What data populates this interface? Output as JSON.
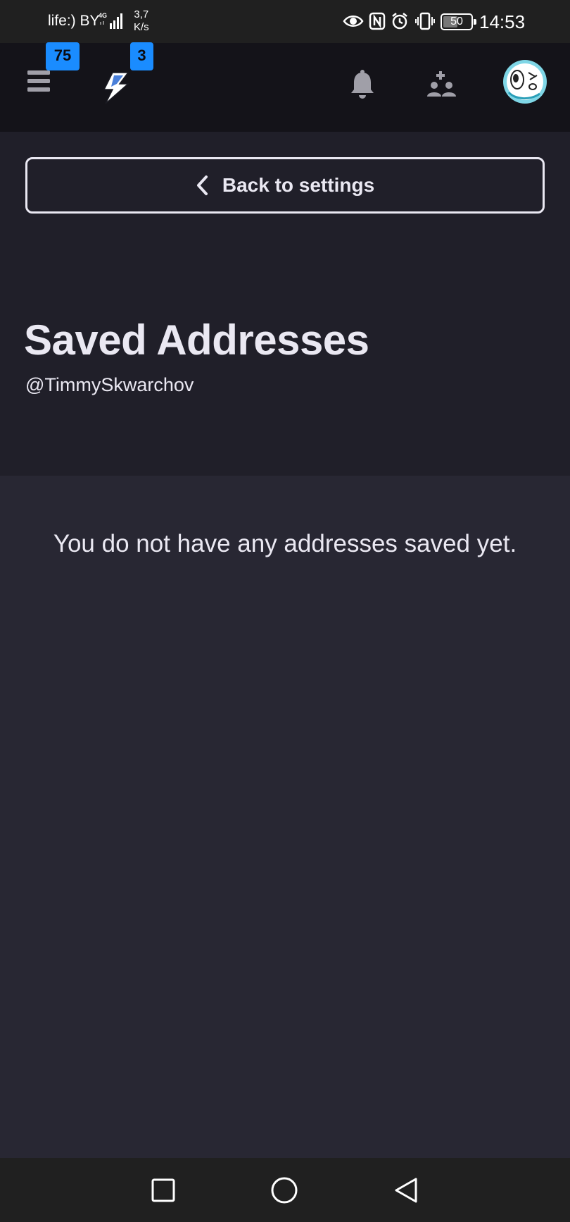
{
  "status_bar": {
    "carrier": "life:) BY",
    "network": "4G",
    "speed_value": "3,7",
    "speed_unit": "K/s",
    "battery": "50",
    "time": "14:53",
    "icons": [
      "eye-icon",
      "nfc-icon",
      "alarm-icon",
      "vibrate-icon",
      "battery-icon"
    ]
  },
  "header": {
    "menu_badge": "75",
    "logo_badge": "3",
    "icons": [
      "menu-icon",
      "lightning-logo-icon",
      "bell-icon",
      "add-friend-icon",
      "avatar"
    ]
  },
  "page": {
    "back_label": "Back to settings",
    "title": "Saved Addresses",
    "username": "@TimmySkwarchov",
    "empty_message": "You do not have any addresses saved yet."
  },
  "nav_bar": {
    "icons": [
      "recent-apps-icon",
      "home-icon",
      "back-icon"
    ]
  },
  "colors": {
    "accent_badge": "#1a8cff",
    "header_bg": "#141319",
    "top_section_bg": "#201f29",
    "main_bg": "#282733",
    "text": "#eae8f2"
  }
}
